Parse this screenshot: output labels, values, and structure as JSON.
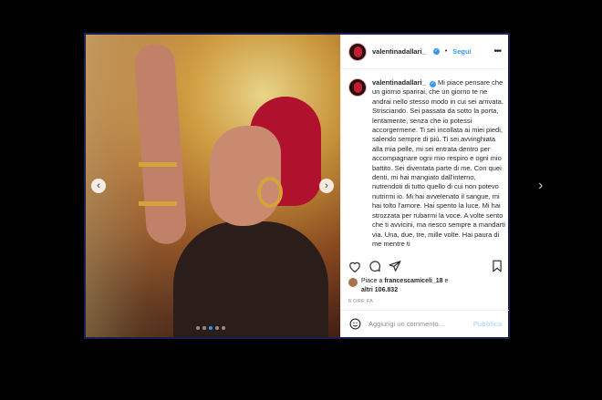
{
  "post": {
    "username": "valentinadallari_",
    "verified_icon": "✓",
    "follow_label": "Segui",
    "more_icon": "•••",
    "caption_username": "valentinadallari_",
    "caption": "Mi piace pensare che un giorno sparirai, che un giorno te ne andrai nello stesso modo in cui sei arrivata. Strisciando. Sei passata da sotto la porta, lentamente, senza che io potessi accorgermene. Ti sei incollata ai miei piedi, salendo sempre di più. Ti sei avvinghiata alla mia pelle, mi sei entrata dentro per accompagnare ogni mio respiro e ogni mio battito. Sei diventata parte di me. Con quei denti, mi hai mangiato dall'interno, nutrendoti di tutto quello di cui non potevo nutrirmi io. Mi hai avvelenato il sangue, mi hai tolto l'amore. Hai spento la luce. Mi hai strozzata per rubarmi la voce. A volte sento che ti avvicini, ma riesco sempre a mandarti via. Una, due, tre, mille volte. Hai paura di me mentre ti",
    "likes_prefix": "Piace a",
    "liked_by": "francescamiceli_18",
    "likes_joiner": "e",
    "likes_others": "altri 106.832",
    "time": "8 ORE FA",
    "comment_placeholder": "Aggiungi un commento...",
    "publish_label": "Pubblica"
  },
  "carousel": {
    "prev_icon": "‹",
    "next_icon": "›",
    "dots_count": 5,
    "active_dot": 2
  },
  "page": {
    "outer_next_icon": "›"
  },
  "colors": {
    "accent": "#3897f0",
    "frame_border": "#1a1f4f",
    "background": "#000000"
  }
}
